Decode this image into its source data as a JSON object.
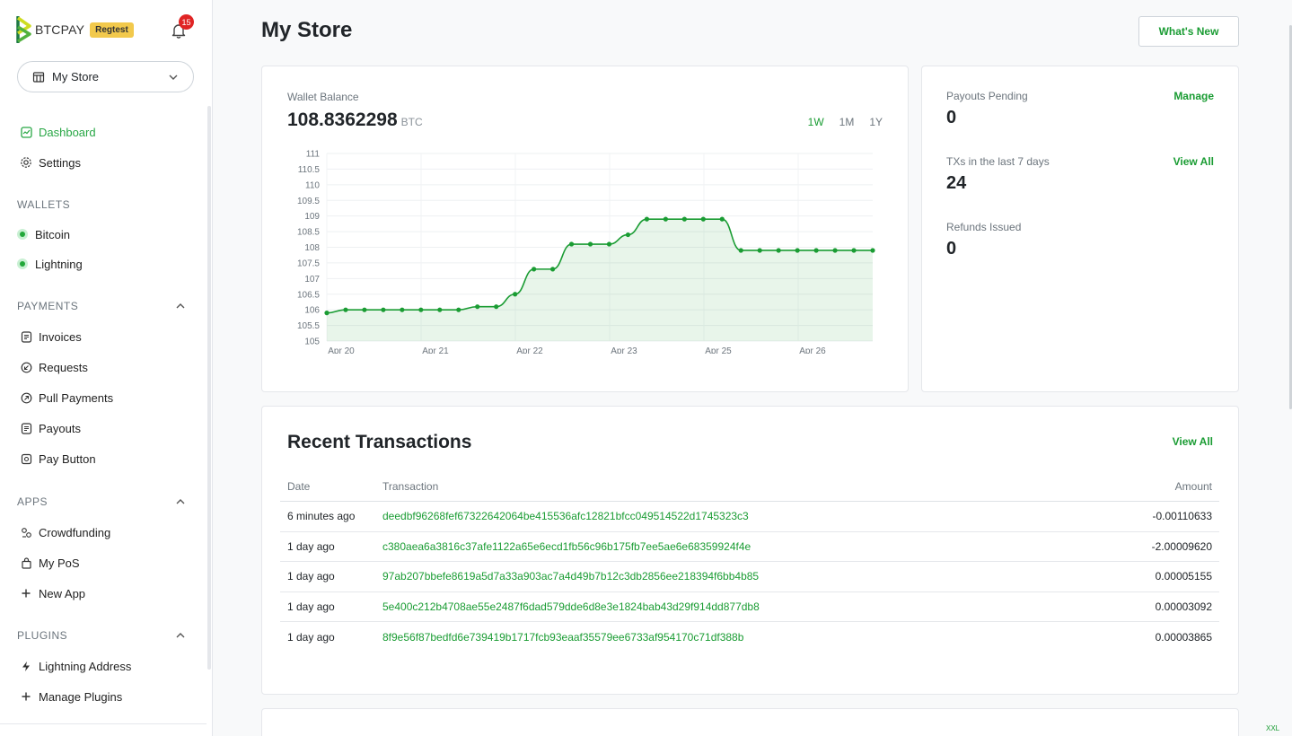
{
  "brand": {
    "name": "BTCPAY",
    "env_badge": "Regtest",
    "notifications": "15"
  },
  "store_selector": {
    "label": "My Store"
  },
  "nav": {
    "dashboard": "Dashboard",
    "settings": "Settings",
    "wallets_head": "WALLETS",
    "bitcoin": "Bitcoin",
    "lightning": "Lightning",
    "payments_head": "PAYMENTS",
    "invoices": "Invoices",
    "requests": "Requests",
    "pull_payments": "Pull Payments",
    "payouts": "Payouts",
    "pay_button": "Pay Button",
    "apps_head": "APPS",
    "crowdfunding": "Crowdfunding",
    "my_pos": "My PoS",
    "new_app": "New App",
    "plugins_head": "PLUGINS",
    "lightning_address": "Lightning Address",
    "manage_plugins": "Manage Plugins"
  },
  "header": {
    "title": "My Store",
    "whats_new": "What's New"
  },
  "wallet": {
    "label": "Wallet Balance",
    "value": "108.8362298",
    "unit": "BTC",
    "ranges": [
      "1W",
      "1M",
      "1Y"
    ],
    "active_range": "1W"
  },
  "chart_data": {
    "type": "area",
    "y_ticks": [
      "111",
      "110.5",
      "110",
      "109.5",
      "109",
      "108.5",
      "108",
      "107.5",
      "107",
      "106.5",
      "106",
      "105.5",
      "105"
    ],
    "x_ticks": [
      "Apr 20",
      "Apr 21",
      "Apr 22",
      "Apr 23",
      "Apr 25",
      "Apr 26"
    ],
    "ylim": [
      105,
      111
    ],
    "values": [
      105.9,
      106.0,
      106.0,
      106.0,
      106.0,
      106.0,
      106.0,
      106.0,
      106.1,
      106.1,
      106.5,
      107.3,
      107.3,
      108.1,
      108.1,
      108.1,
      108.4,
      108.9,
      108.9,
      108.9,
      108.9,
      108.9,
      107.9,
      107.9,
      107.9,
      107.9,
      107.9,
      107.9,
      107.9,
      107.9
    ],
    "grid": true,
    "color": "#1a9c33"
  },
  "stats": {
    "payouts_pending": {
      "label": "Payouts Pending",
      "value": "0",
      "link": "Manage"
    },
    "txs": {
      "label": "TXs in the last 7 days",
      "value": "24",
      "link": "View All"
    },
    "refunds": {
      "label": "Refunds Issued",
      "value": "0"
    }
  },
  "transactions": {
    "title": "Recent Transactions",
    "view_all": "View All",
    "columns": [
      "Date",
      "Transaction",
      "Amount"
    ],
    "rows": [
      {
        "date": "6 minutes ago",
        "tx": "deedbf96268fef67322642064be415536afc12821bfcc049514522d1745323c3",
        "amount": "-0.00110633",
        "sign": "neg"
      },
      {
        "date": "1 day ago",
        "tx": "c380aea6a3816c37afe1122a65e6ecd1fb56c96b175fb7ee5ae6e68359924f4e",
        "amount": "-2.00009620",
        "sign": "neg"
      },
      {
        "date": "1 day ago",
        "tx": "97ab207bbefe8619a5d7a33a903ac7a4d49b7b12c3db2856ee218394f6bb4b85",
        "amount": "0.00005155",
        "sign": "pos"
      },
      {
        "date": "1 day ago",
        "tx": "5e400c212b4708ae55e2487f6dad579dde6d8e3e1824bab43d29f914dd877db8",
        "amount": "0.00003092",
        "sign": "pos"
      },
      {
        "date": "1 day ago",
        "tx": "8f9e56f87bedfd6e739419b1717fcb93eaaf35579ee6733af954170c71df388b",
        "amount": "0.00003865",
        "sign": "pos"
      }
    ]
  },
  "footer_tag": "XXL"
}
